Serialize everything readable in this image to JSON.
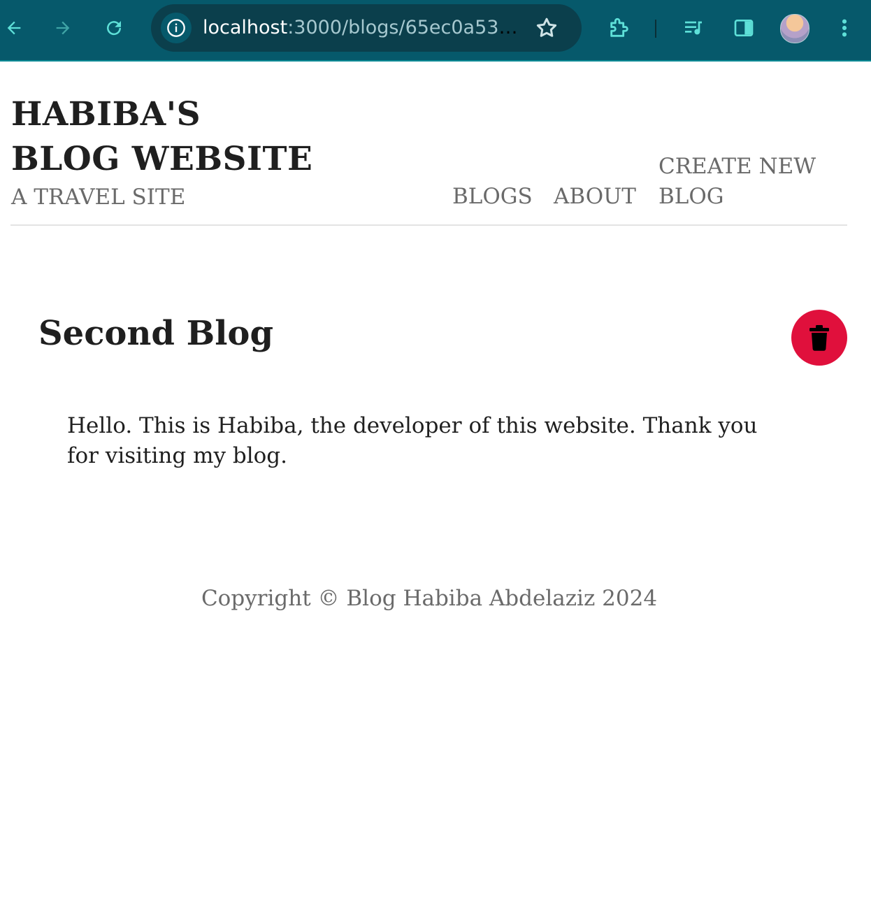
{
  "browser": {
    "url_host": "localhost",
    "url_path": ":3000/blogs/65ec0a53718...",
    "icons": [
      "back-icon",
      "forward-icon",
      "reload-icon",
      "site-info-icon",
      "bookmark-star-icon",
      "extensions-icon",
      "media-control-icon",
      "side-panel-icon",
      "profile-avatar",
      "menu-kebab-icon"
    ],
    "colors": {
      "toolbar": "#06596b",
      "omnibox": "#0b3f4c",
      "accent": "#5ee0d8"
    }
  },
  "header": {
    "title": "HABIBA'S BLOG WEBSITE",
    "subtitle": "A TRAVEL SITE",
    "nav": {
      "blogs": "BLOGS",
      "about": "ABOUT",
      "create": "CREATE NEW BLOG"
    }
  },
  "blog": {
    "title": "Second Blog",
    "body": "Hello. This is Habiba, the developer of this website. Thank you for visiting my blog.",
    "delete_icon": "trash-icon",
    "delete_color": "#e0103c"
  },
  "footer": {
    "text": "Copyright © Blog Habiba Abdelaziz 2024"
  }
}
